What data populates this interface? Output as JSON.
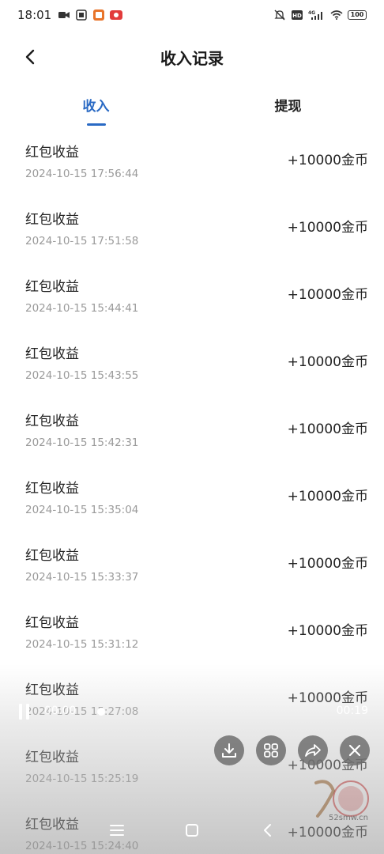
{
  "status_bar": {
    "time": "18:01",
    "battery": "100",
    "network": "4G"
  },
  "header": {
    "title": "收入记录"
  },
  "tabs": [
    {
      "label": "收入",
      "active": true
    },
    {
      "label": "提现",
      "active": false
    }
  ],
  "records": [
    {
      "title": "红包收益",
      "time": "2024-10-15 17:56:44",
      "amount": "+10000金币"
    },
    {
      "title": "红包收益",
      "time": "2024-10-15 17:51:58",
      "amount": "+10000金币"
    },
    {
      "title": "红包收益",
      "time": "2024-10-15 15:44:41",
      "amount": "+10000金币"
    },
    {
      "title": "红包收益",
      "time": "2024-10-15 15:43:55",
      "amount": "+10000金币"
    },
    {
      "title": "红包收益",
      "time": "2024-10-15 15:42:31",
      "amount": "+10000金币"
    },
    {
      "title": "红包收益",
      "time": "2024-10-15 15:35:04",
      "amount": "+10000金币"
    },
    {
      "title": "红包收益",
      "time": "2024-10-15 15:33:37",
      "amount": "+10000金币"
    },
    {
      "title": "红包收益",
      "time": "2024-10-15 15:31:12",
      "amount": "+10000金币"
    },
    {
      "title": "红包收益",
      "time": "2024-10-15 15:27:08",
      "amount": "+10000金币"
    },
    {
      "title": "红包收益",
      "time": "2024-10-15 15:25:19",
      "amount": "+10000金币"
    },
    {
      "title": "红包收益",
      "time": "2024-10-15 15:24:40",
      "amount": "+10000金币"
    }
  ],
  "player": {
    "current_time": "00:00",
    "total_time": "00:19"
  },
  "watermark": {
    "text": "52smw.cn"
  },
  "colors": {
    "accent": "#2a6ac4",
    "secondary_text": "#9a9a9a"
  }
}
